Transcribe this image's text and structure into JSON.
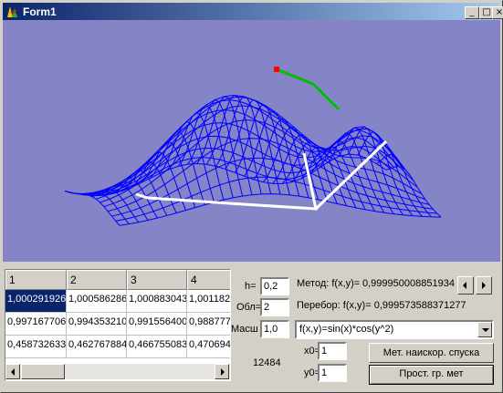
{
  "window": {
    "title": "Form1",
    "minimize_glyph": "_",
    "maximize_glyph": "□",
    "close_glyph": "×"
  },
  "colors": {
    "plot_background": "#8484c6",
    "mesh": "#0000ff",
    "path_primary": "#ffffff",
    "path_secondary": "#00c000",
    "marker": "#ff0000",
    "selection": "#0a246a"
  },
  "table": {
    "headers": [
      "1",
      "2",
      "3",
      "4"
    ],
    "rows": [
      [
        "1,000291926",
        "1,000586286",
        "1,000883043",
        "1,001182"
      ],
      [
        "0,997167706",
        "0,994353210",
        "0,991556400",
        "0,988777"
      ],
      [
        "0,458732633",
        "0,462767884",
        "0,466755083",
        "0,470694"
      ]
    ]
  },
  "params": {
    "h_label": "h=",
    "h_value": "0,2",
    "area_label": "Обл=",
    "area_value": "2",
    "scale_label": "Масш",
    "scale_value": "1,0",
    "counter": "12484",
    "x0_label": "x0=",
    "x0_value": "1",
    "y0_label": "y0=",
    "y0_value": "1"
  },
  "results": {
    "method_label": "Метод: f(x,y)=",
    "method_value": "0,999950008851934",
    "search_text": "Перебор: f(x,y)= 0,999573588371277"
  },
  "function_select": {
    "selected": "f(x,y)=sin(x)*cos(y^2)"
  },
  "buttons": {
    "steepest_descent": "Мет. наискор. спуска",
    "simple_gradient": "Прост. гр. мет"
  }
}
